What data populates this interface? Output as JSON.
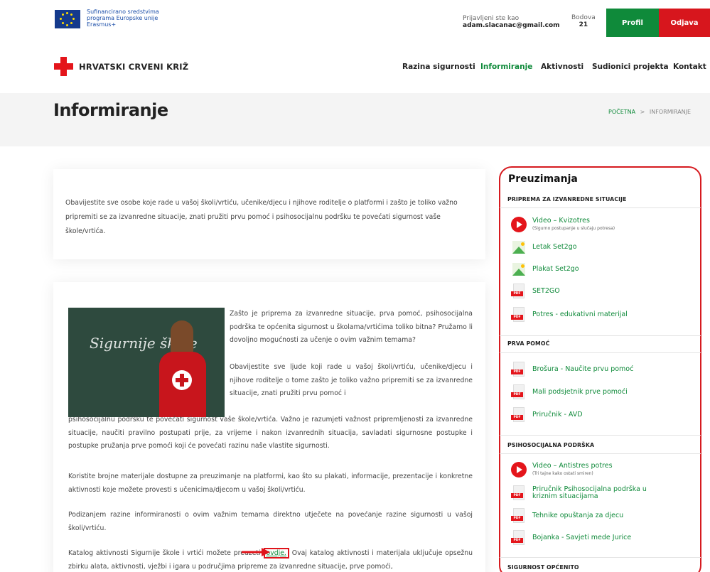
{
  "topbar": {
    "eu_text": [
      "Sufinancirano sredstvima",
      "programa Europske unije",
      "Erasmus+"
    ],
    "logged_in_label": "Prijavljeni ste kao",
    "logged_in_email": "adam.slacanac@gmail.com",
    "points_label": "Bodova",
    "points_value": "21",
    "profile_label": "Profil",
    "logout_label": "Odjava"
  },
  "header": {
    "logo_text": "HRVATSKI CRVENI KRIŽ",
    "nav": [
      "Razina sigurnosti",
      "Informiranje",
      "Aktivnosti",
      "Sudionici projekta",
      "Kontakt"
    ],
    "active_nav": "Informiranje"
  },
  "title_band": {
    "title": "Informiranje",
    "breadcrumb_home": "POČETNA",
    "breadcrumb_sep": ">",
    "breadcrumb_current": "INFORMIRANJE"
  },
  "intro": {
    "text": "Obavijestite sve osobe koje rade u vašoj školi/vrtiću, učenike/djecu i njihove roditelje o platformi i zašto je toliko važno pripremiti se za izvanredne situacije, znati pružiti prvu pomoć i psihosocijalnu podršku te povećati sigurnost vaše škole/vrtića."
  },
  "article": {
    "image_text": "Sigurnije škole",
    "p1": "Zašto je priprema za izvanredne situacije, prva pomoć, psihosocijalna podrška te općenita sigurnost u školama/vrtićima toliko bitna? Pružamo li dovoljno mogućnosti za učenje o ovim važnim temama?",
    "p2a": "Obavijestite sve ljude koji rade u vašoj školi/vrtiću, učenike/djecu i njihove roditelje o tome zašto je toliko važno pripremiti se za izvanredne situacije, znati pružiti prvu pomoć i",
    "p2b": "psihosocijalnu podršku te povećati sigurnost vaše škole/vrtića. Važno je razumjeti važnost pripremljenosti za izvanredne situacije, naučiti pravilno postupati prije, za vrijeme i nakon izvanrednih situacija, savladati sigurnosne postupke i postupke pružanja prve pomoći koji će povećati razinu naše vlastite sigurnosti.",
    "p3": "Koristite brojne materijale dostupne za preuzimanje na platformi, kao što su plakati, informacije, prezentacije i konkretne aktivnosti koje možete provesti s učenicima/djecom u vašoj školi/vrtiću.",
    "p4": "Podizanjem razine informiranosti o ovim važnim temama direktno utječete na povećanje razine sigurnosti u vašoj školi/vrtiću.",
    "p5_before": "Katalog aktivnosti Sigurnije škole i vrtići možete preuzeti",
    "p5_link": "ovdje.",
    "p5_after": "Ovaj katalog aktivnosti i materijala uključuje",
    "p5_line2": "opsežnu zbirku alata, aktivnosti, vježbi i igara u područjima pripreme za izvanredne situacije, prve pomoći,"
  },
  "sidebar": {
    "title": "Preuzimanja",
    "sections": [
      {
        "heading": "PRIPREMA ZA IZVANREDNE SITUACIJE",
        "items": [
          {
            "type": "video",
            "label": "Video – Kvizotres",
            "sub": "(Sigurno postupanje u slučaju potresa)"
          },
          {
            "type": "image",
            "label": "Letak Set2go",
            "sub": ""
          },
          {
            "type": "image",
            "label": "Plakat Set2go",
            "sub": ""
          },
          {
            "type": "pdf",
            "label": "SET2GO",
            "sub": ""
          },
          {
            "type": "pdf",
            "label": "Potres - edukativni materijal",
            "sub": ""
          }
        ]
      },
      {
        "heading": "PRVA POMOĆ",
        "items": [
          {
            "type": "pdf",
            "label": "Brošura - Naučite prvu pomoć",
            "sub": ""
          },
          {
            "type": "pdf",
            "label": "Mali podsjetnik prve pomoći",
            "sub": ""
          },
          {
            "type": "pdf",
            "label": "Priručnik - AVD",
            "sub": ""
          }
        ]
      },
      {
        "heading": "PSIHOSOCIJALNA PODRŠKA",
        "items": [
          {
            "type": "video",
            "label": "Video – Antistres potres",
            "sub": "(Tri tajne kako ostati smiren)"
          },
          {
            "type": "pdf",
            "label": "Priručnik Psihosocijalna podrška u kriznim situacijama",
            "sub": ""
          },
          {
            "type": "pdf",
            "label": "Tehnike opuštanja za djecu",
            "sub": ""
          },
          {
            "type": "pdf",
            "label": "Bojanka - Savjeti mede Jurice",
            "sub": ""
          }
        ]
      },
      {
        "heading": "SIGURNOST OPĆENITO",
        "items": []
      }
    ]
  },
  "colors": {
    "brand_red": "#e4151b",
    "brand_green": "#0f8a3a"
  }
}
